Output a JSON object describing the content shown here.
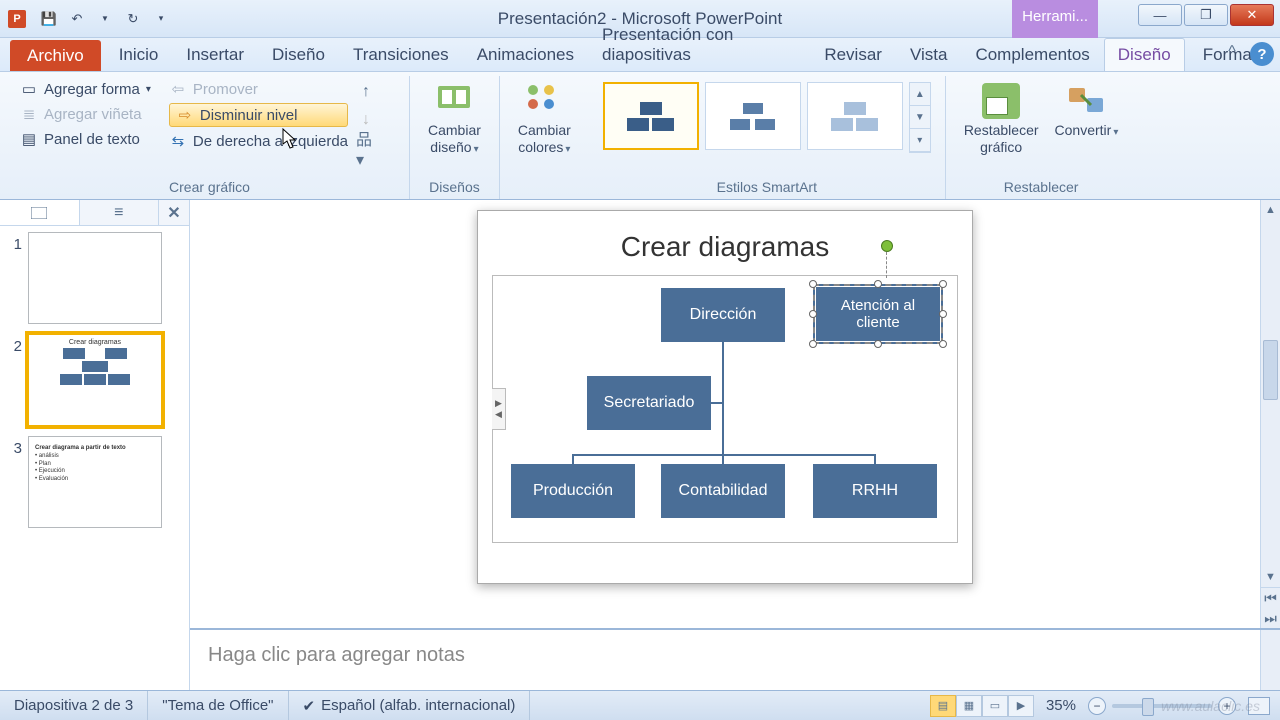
{
  "app": {
    "title": "Presentación2  -  Microsoft PowerPoint",
    "tool_context_tab": "Herrami..."
  },
  "ribbon_tabs": {
    "file": "Archivo",
    "home": "Inicio",
    "insert": "Insertar",
    "design": "Diseño",
    "transitions": "Transiciones",
    "animations": "Animaciones",
    "slideshow": "Presentación con diapositivas",
    "review": "Revisar",
    "view": "Vista",
    "addins": "Complementos",
    "smartart_design": "Diseño",
    "smartart_format": "Formato"
  },
  "ribbon": {
    "create_graphic": {
      "add_shape": "Agregar forma",
      "add_bullet": "Agregar viñeta",
      "text_pane": "Panel de texto",
      "promote": "Promover",
      "demote": "Disminuir nivel",
      "rtl": "De derecha a izquierda",
      "group_label": "Crear gráfico"
    },
    "layouts": {
      "change_layout_line1": "Cambiar",
      "change_layout_line2": "diseño",
      "change_colors_line1": "Cambiar",
      "change_colors_line2": "colores",
      "group_label": "Diseños"
    },
    "styles": {
      "group_label": "Estilos SmartArt"
    },
    "reset": {
      "reset_line1": "Restablecer",
      "reset_line2": "gráfico",
      "convert": "Convertir",
      "group_label": "Restablecer"
    }
  },
  "chart_data": {
    "type": "org-chart",
    "title": "Crear diagramas",
    "nodes": [
      {
        "id": "direccion",
        "label": "Dirección",
        "level": 1
      },
      {
        "id": "atencion",
        "label": "Atención al cliente",
        "level": 1,
        "selected": true
      },
      {
        "id": "secretariado",
        "label": "Secretariado",
        "level": 2,
        "assistant_of": "direccion"
      },
      {
        "id": "produccion",
        "label": "Producción",
        "level": 3,
        "parent": "direccion"
      },
      {
        "id": "contabilidad",
        "label": "Contabilidad",
        "level": 3,
        "parent": "direccion"
      },
      {
        "id": "rrhh",
        "label": "RRHH",
        "level": 3,
        "parent": "direccion"
      }
    ]
  },
  "thumbs": {
    "t1": "1",
    "t2": "2",
    "t3": "3",
    "t2_title": "Crear diagramas",
    "t3_title": "Crear diagrama a partir de texto",
    "t3_b1": "• análisis",
    "t3_b2": "• Plan",
    "t3_b3": "• Ejecución",
    "t3_b4": "• Evaluación"
  },
  "notes": {
    "placeholder": "Haga clic para agregar notas"
  },
  "status": {
    "slide_of": "Diapositiva 2 de 3",
    "theme": "\"Tema de Office\"",
    "language": "Español (alfab. internacional)",
    "zoom": "35%"
  },
  "watermark": "www.aulaclic.es"
}
